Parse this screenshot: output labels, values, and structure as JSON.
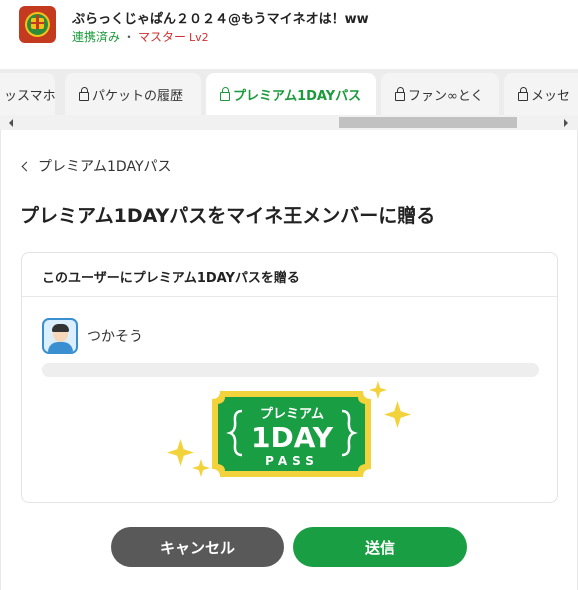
{
  "user": {
    "name": "ぷらっくじゃぱん２０２４@もうマイネオは！ww",
    "linked": "連携済み",
    "separator": "・",
    "rank": "マスター",
    "level": "Lv2"
  },
  "tabs": [
    {
      "label": "ッスマホ",
      "locked": false
    },
    {
      "label": "パケットの履歴",
      "locked": true
    },
    {
      "label": "プレミアム1DAYパス",
      "locked": true,
      "active": true
    },
    {
      "label": "ファン∞とく",
      "locked": true
    },
    {
      "label": "メッセ",
      "locked": true
    }
  ],
  "breadcrumb": "プレミアム1DAYパス",
  "page_title": "プレミアム1DAYパスをマイネ王メンバーに贈る",
  "card": {
    "title": "このユーザーにプレミアム1DAYパスを贈る",
    "member_name": "つかそう"
  },
  "ticket": {
    "line1": "プレミアム",
    "line2": "1DAY",
    "line3": "PASS"
  },
  "buttons": {
    "cancel": "キャンセル",
    "send": "送信"
  },
  "colors": {
    "accent_green": "#1a9e44",
    "cancel_gray": "#595959",
    "rank_red": "#d32f2f",
    "ticket_gold": "#f3d33c"
  }
}
